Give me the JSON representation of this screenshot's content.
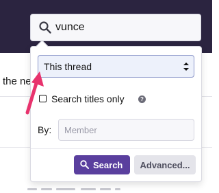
{
  "search": {
    "value": "vunce",
    "icon": "search-icon"
  },
  "background": {
    "snippet": "the ne"
  },
  "dropdown": {
    "scope": {
      "selected": "This thread",
      "icon": "select-arrows-icon"
    },
    "titles_only": {
      "label": "Search titles only",
      "checked": false,
      "help_icon": "question-icon",
      "help_glyph": "?"
    },
    "by": {
      "label": "By:",
      "placeholder": "Member"
    },
    "buttons": {
      "search": "Search",
      "advanced": "Advanced..."
    }
  },
  "colors": {
    "header": "#2b2440",
    "primary_button": "#5a3f9e",
    "annotation_arrow": "#e8336d"
  }
}
